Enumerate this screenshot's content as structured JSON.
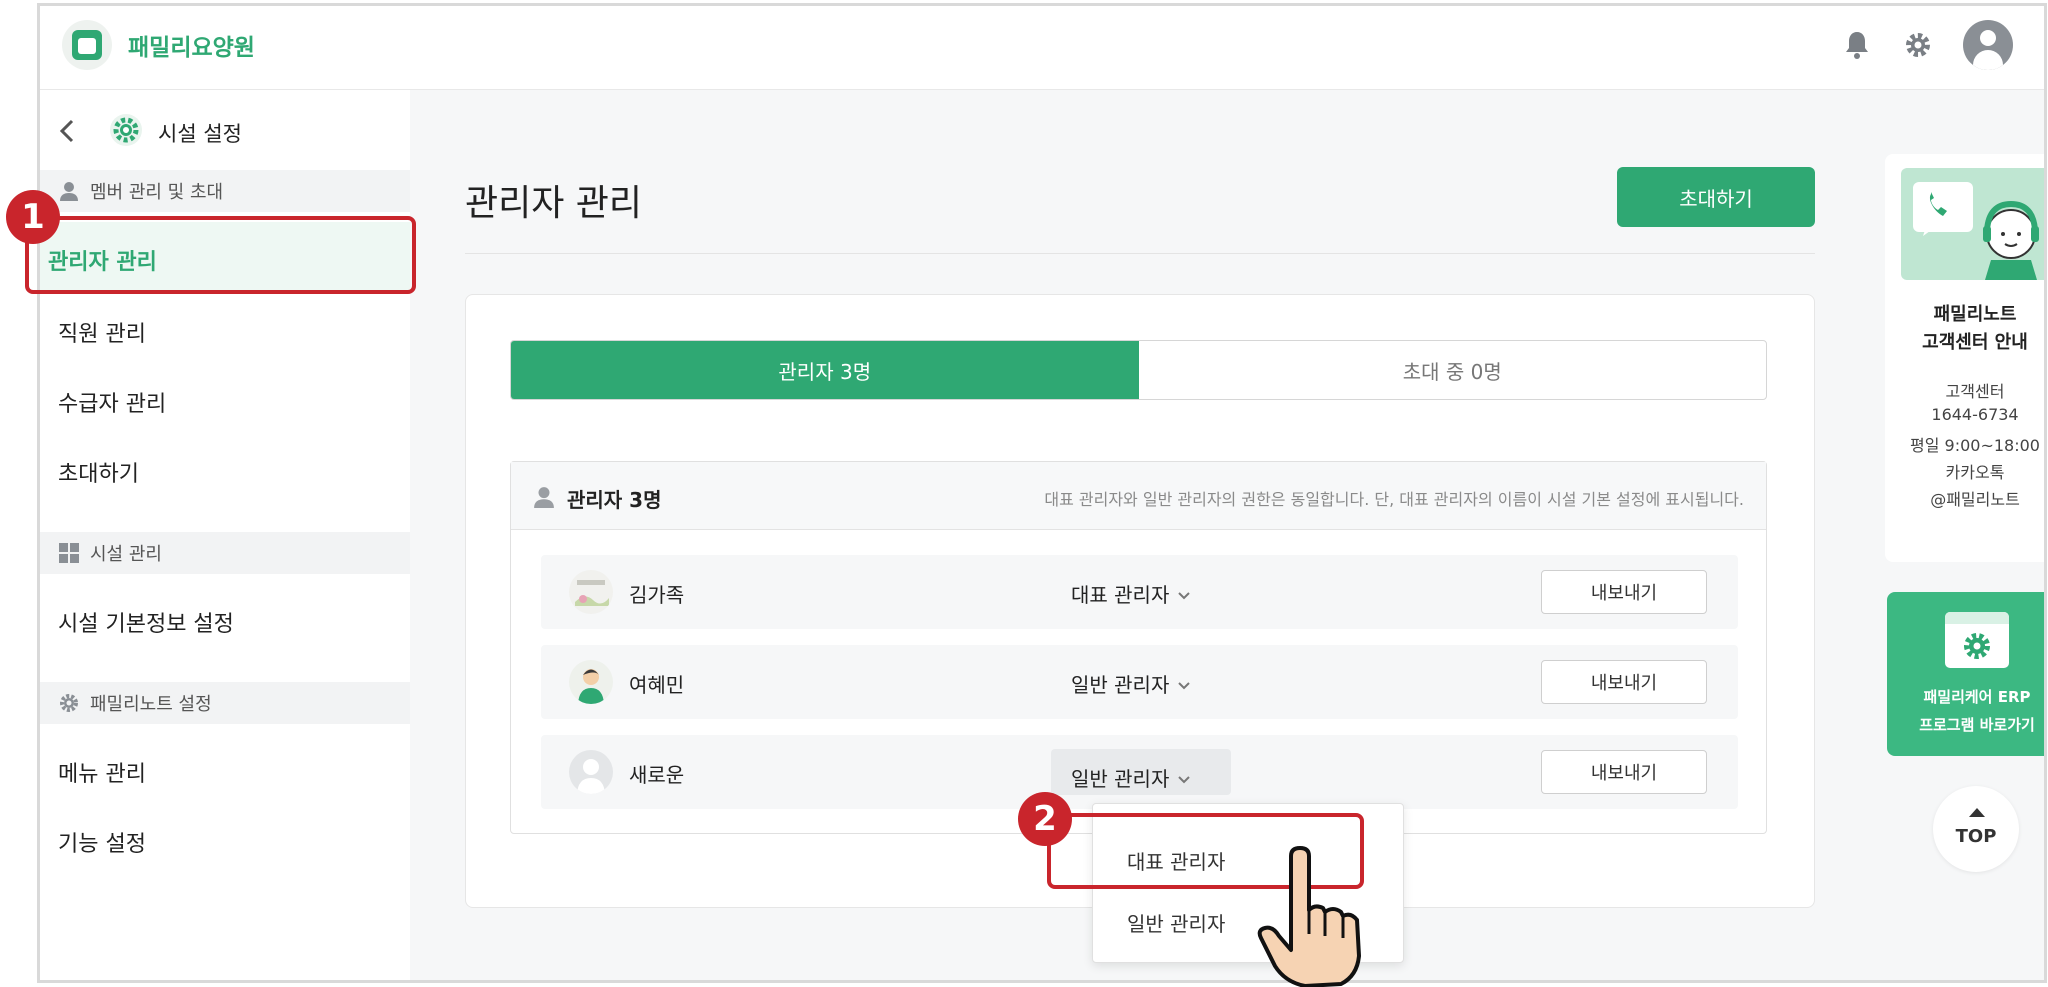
{
  "app": {
    "name": "패밀리요양원"
  },
  "sidebar": {
    "back_label": "<",
    "title": "시설 설정",
    "sections": [
      {
        "label": "멤버 관리 및 초대",
        "icon": "person-icon"
      },
      {
        "label": "시설 관리",
        "icon": "grid-icon"
      },
      {
        "label": "패밀리노트 설정",
        "icon": "gear-icon"
      }
    ],
    "items": [
      {
        "label": "관리자 관리",
        "active": true
      },
      {
        "label": "직원 관리"
      },
      {
        "label": "수급자 관리"
      },
      {
        "label": "초대하기"
      },
      {
        "label": "시설 기본정보 설정"
      },
      {
        "label": "메뉴 관리"
      },
      {
        "label": "기능 설정"
      }
    ]
  },
  "main": {
    "page_title": "관리자 관리",
    "invite_button": "초대하기",
    "tabs": [
      {
        "label": "관리자 3명",
        "active": true
      },
      {
        "label": "초대 중 0명"
      }
    ],
    "list_title": "관리자 3명",
    "list_note": "대표 관리자와 일반 관리자의 권한은 동일합니다. 단, 대표 관리자의 이름이 시설 기본 설정에 표시됩니다.",
    "rows": [
      {
        "name": "김가족",
        "role": "대표 관리자",
        "export": "내보내기"
      },
      {
        "name": "여혜민",
        "role": "일반 관리자",
        "export": "내보내기"
      },
      {
        "name": "새로운",
        "role": "일반 관리자",
        "export": "내보내기"
      }
    ],
    "dropdown": {
      "options": [
        "대표 관리자",
        "일반 관리자"
      ],
      "selected": "대표 관리자"
    }
  },
  "callouts": {
    "one": "1",
    "two": "2"
  },
  "support": {
    "title_line1": "패밀리노트",
    "title_line2": "고객센터 안내",
    "lines": [
      "고객센터",
      "1644-6734",
      "평일 9:00~18:00",
      "카카오톡",
      "@패밀리노트"
    ]
  },
  "erp": {
    "line1": "패밀리케어 ERP",
    "line2": "프로그램 바로가기"
  },
  "top_button": "TOP",
  "colors": {
    "accent": "#2fa873",
    "callout": "#c9252c"
  }
}
